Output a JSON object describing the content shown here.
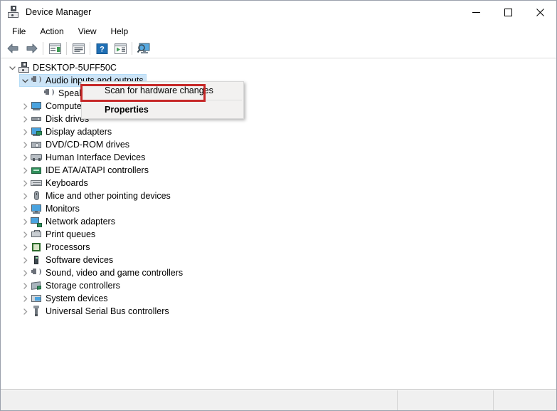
{
  "window": {
    "title": "Device Manager",
    "icon": "device-manager-icon",
    "controls": {
      "minimize": "—",
      "maximize": "□",
      "close": "✕"
    }
  },
  "menubar": {
    "items": [
      "File",
      "Action",
      "View",
      "Help"
    ]
  },
  "toolbar": {
    "buttons": [
      {
        "name": "back-button",
        "icon": "back-arrow-icon"
      },
      {
        "name": "forward-button",
        "icon": "forward-arrow-icon"
      },
      {
        "name": "properties-button",
        "icon": "properties-icon"
      },
      {
        "name": "show-hidden-devices-button",
        "icon": "list-view-icon"
      },
      {
        "name": "help-button",
        "icon": "help-question-icon"
      },
      {
        "name": "update-driver-button",
        "icon": "update-driver-icon"
      },
      {
        "name": "scan-for-hardware-changes-button",
        "icon": "scan-monitor-icon"
      }
    ]
  },
  "tree": {
    "root": {
      "label": "DESKTOP-5UFF50C",
      "icon": "computer-tower-icon",
      "expanded": true
    },
    "items": [
      {
        "label": "Audio inputs and outputs",
        "icon": "speaker-icon",
        "expanded": true,
        "selected": true,
        "indent": 1
      },
      {
        "label": "Speakers",
        "icon": "speaker-icon",
        "expanded": false,
        "selected": false,
        "indent": 2,
        "leaf": true
      },
      {
        "label": "Computer",
        "icon": "monitor-icon",
        "expanded": false,
        "selected": false,
        "indent": 1
      },
      {
        "label": "Disk drives",
        "icon": "disk-drive-icon",
        "expanded": false,
        "selected": false,
        "indent": 1
      },
      {
        "label": "Display adapters",
        "icon": "display-adapter-icon",
        "expanded": false,
        "selected": false,
        "indent": 1
      },
      {
        "label": "DVD/CD-ROM drives",
        "icon": "dvd-drive-icon",
        "expanded": false,
        "selected": false,
        "indent": 1
      },
      {
        "label": "Human Interface Devices",
        "icon": "hid-icon",
        "expanded": false,
        "selected": false,
        "indent": 1
      },
      {
        "label": "IDE ATA/ATAPI controllers",
        "icon": "ide-controller-icon",
        "expanded": false,
        "selected": false,
        "indent": 1
      },
      {
        "label": "Keyboards",
        "icon": "keyboard-icon",
        "expanded": false,
        "selected": false,
        "indent": 1
      },
      {
        "label": "Mice and other pointing devices",
        "icon": "mouse-icon",
        "expanded": false,
        "selected": false,
        "indent": 1
      },
      {
        "label": "Monitors",
        "icon": "monitor-icon",
        "expanded": false,
        "selected": false,
        "indent": 1
      },
      {
        "label": "Network adapters",
        "icon": "network-adapter-icon",
        "expanded": false,
        "selected": false,
        "indent": 1
      },
      {
        "label": "Print queues",
        "icon": "printer-icon",
        "expanded": false,
        "selected": false,
        "indent": 1
      },
      {
        "label": "Processors",
        "icon": "processor-icon",
        "expanded": false,
        "selected": false,
        "indent": 1
      },
      {
        "label": "Software devices",
        "icon": "software-device-icon",
        "expanded": false,
        "selected": false,
        "indent": 1
      },
      {
        "label": "Sound, video and game controllers",
        "icon": "speaker-icon",
        "expanded": false,
        "selected": false,
        "indent": 1
      },
      {
        "label": "Storage controllers",
        "icon": "storage-controller-icon",
        "expanded": false,
        "selected": false,
        "indent": 1
      },
      {
        "label": "System devices",
        "icon": "system-device-icon",
        "expanded": false,
        "selected": false,
        "indent": 1
      },
      {
        "label": "Universal Serial Bus controllers",
        "icon": "usb-controller-icon",
        "expanded": false,
        "selected": false,
        "indent": 1
      }
    ]
  },
  "context_menu": {
    "items": [
      {
        "label": "Scan for hardware changes",
        "bold": false,
        "highlighted": true
      },
      {
        "label": "Properties",
        "bold": true,
        "highlighted": false
      }
    ]
  },
  "highlight": {
    "color": "#c62828"
  },
  "colors": {
    "selection": "#cce4f7",
    "menu_bg": "#f2f1f0",
    "window_bg": "#f0f0f0"
  },
  "statusbar": {
    "panels": [
      "",
      "",
      ""
    ]
  }
}
